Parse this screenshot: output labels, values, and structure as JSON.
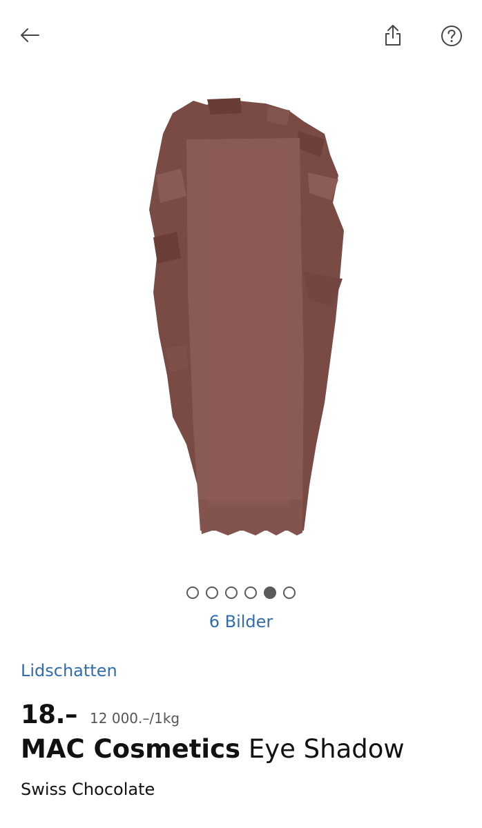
{
  "header": {
    "back_icon": "arrow-left-icon",
    "share_icon": "share-icon",
    "help_icon": "question-circle-icon"
  },
  "gallery": {
    "image_description": "eyeshadow-swatch",
    "swatch_color": "#8a5a55",
    "dots_total": 6,
    "active_dot_index": 4,
    "count_label": "6 Bilder"
  },
  "product": {
    "category": "Lidschatten",
    "price": "18.–",
    "unit_price": "12 000.–/1kg",
    "brand": "MAC Cosmetics",
    "name": "Eye Shadow",
    "variant": "Swiss Chocolate"
  },
  "colors": {
    "link_blue": "#2f6db0",
    "text_dark": "#111111",
    "dot_gray": "#5a5a5a"
  }
}
